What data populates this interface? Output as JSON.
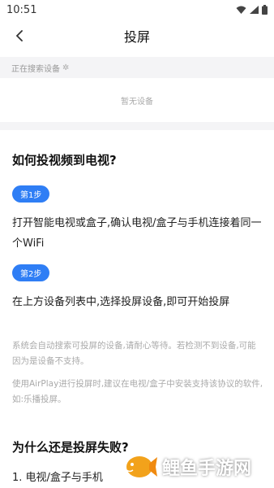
{
  "status_bar": {
    "time": "10:51"
  },
  "nav": {
    "title": "投屏"
  },
  "devices": {
    "searching_label": "正在搜索设备",
    "empty_label": "暂无设备"
  },
  "help": {
    "title": "如何投视频到电视?",
    "steps": [
      {
        "badge": "第1步",
        "text": "打开智能电视或盒子,确认电视/盒子与手机连接着同一个WiFi"
      },
      {
        "badge": "第2步",
        "text": "在上方设备列表中,选择投屏设备,即可开始投屏"
      }
    ],
    "notes": [
      "系统会自动搜索可投屏的设备,请耐心等待。若检测不到设备,可能因为是设备不支持。",
      "使用AirPlay进行投屏时,建议在电视/盒子中安装支持该协议的软件,如:乐播投屏。"
    ]
  },
  "failure": {
    "title": "为什么还是投屏失败?",
    "items": [
      "1. 电视/盒子与手机"
    ]
  },
  "watermark": {
    "text": "鲤鱼手游网"
  },
  "colors": {
    "accent": "#2f7ef5",
    "section_bg": "#f4f4f6"
  }
}
